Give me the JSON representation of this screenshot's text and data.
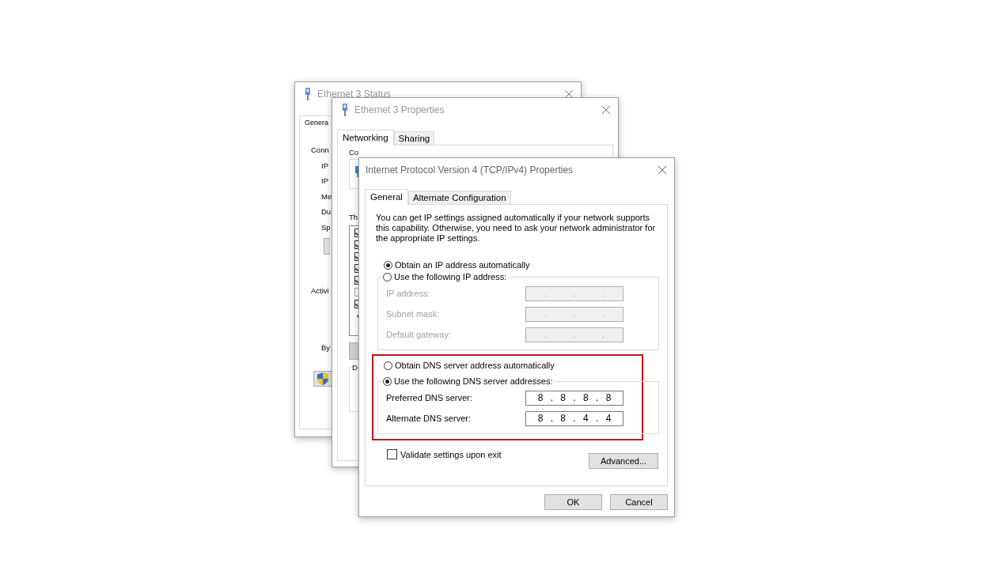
{
  "status_window": {
    "title": "Ethernet 3 Status",
    "tabs": [
      {
        "label": "Genera",
        "selected": true
      }
    ],
    "connection": {
      "label": "Conn",
      "items": [
        "IP",
        "IP",
        "Me",
        "Du",
        "Sp"
      ]
    },
    "activity": {
      "label": "Activi",
      "items": [
        "By"
      ]
    }
  },
  "properties_window": {
    "title": "Ethernet 3 Properties",
    "tabs": [
      {
        "label": "Networking",
        "selected": true
      },
      {
        "label": "Sharing",
        "selected": false
      }
    ],
    "connect_label": "Co",
    "components_label": "Th",
    "components": [
      {
        "checked": true
      },
      {
        "checked": true
      },
      {
        "checked": true
      },
      {
        "checked": true
      },
      {
        "checked": true
      },
      {
        "checked": false
      },
      {
        "checked": true
      }
    ],
    "group_label": "D"
  },
  "ipv4_window": {
    "title": "Internet Protocol Version 4 (TCP/IPv4) Properties",
    "tabs": [
      {
        "label": "General",
        "selected": true
      },
      {
        "label": "Alternate Configuration",
        "selected": false
      }
    ],
    "description": "You can get IP settings assigned automatically if your network supports this capability. Otherwise, you need to ask your network administrator for the appropriate IP settings.",
    "ip_options": [
      {
        "label": "Obtain an IP address automatically",
        "selected": true
      },
      {
        "label": "Use the following IP address:",
        "selected": false
      }
    ],
    "ip_fields": [
      {
        "label": "IP address:",
        "value": ".  .  .",
        "disabled": true
      },
      {
        "label": "Subnet mask:",
        "value": ".  .  .",
        "disabled": true
      },
      {
        "label": "Default gateway:",
        "value": ".  .  .",
        "disabled": true
      }
    ],
    "dns_options": [
      {
        "label": "Obtain DNS server address automatically",
        "selected": false
      },
      {
        "label": "Use the following DNS server addresses:",
        "selected": true
      }
    ],
    "dns_fields": [
      {
        "label": "Preferred DNS server:",
        "value": "8 . 8 . 8 . 8",
        "disabled": false
      },
      {
        "label": "Alternate DNS server:",
        "value": "8 . 8 . 4 . 4",
        "disabled": false
      }
    ],
    "dns_highlighted": true,
    "validate": {
      "label": "Validate settings upon exit",
      "checked": false
    },
    "advanced_button": "Advanced...",
    "buttons": [
      "OK",
      "Cancel"
    ]
  }
}
